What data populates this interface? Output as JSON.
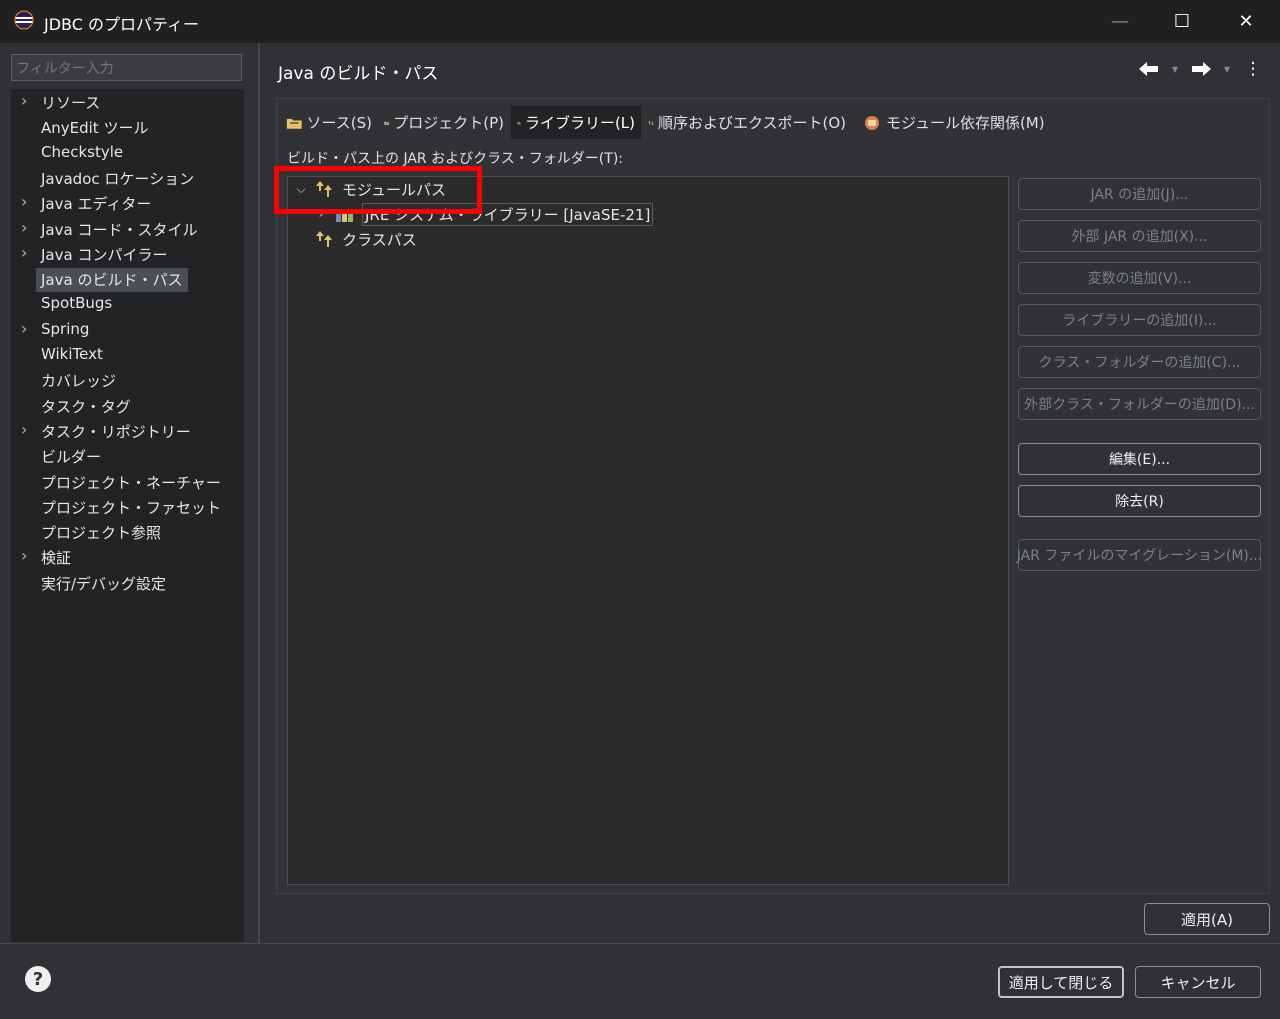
{
  "window": {
    "title": "JDBC のプロパティー",
    "minimize_glyph": "—",
    "maximize_glyph": "☐",
    "close_glyph": "✕"
  },
  "sidebar": {
    "filter_placeholder": "フィルター入力",
    "items": [
      {
        "label": "リソース",
        "expandable": true
      },
      {
        "label": "AnyEdit ツール",
        "expandable": false
      },
      {
        "label": "Checkstyle",
        "expandable": false
      },
      {
        "label": "Javadoc ロケーション",
        "expandable": false
      },
      {
        "label": "Java エディター",
        "expandable": true
      },
      {
        "label": "Java コード・スタイル",
        "expandable": true
      },
      {
        "label": "Java コンパイラー",
        "expandable": true
      },
      {
        "label": "Java のビルド・パス",
        "expandable": false,
        "selected": true
      },
      {
        "label": "SpotBugs",
        "expandable": false
      },
      {
        "label": "Spring",
        "expandable": true
      },
      {
        "label": "WikiText",
        "expandable": false
      },
      {
        "label": "カバレッジ",
        "expandable": false
      },
      {
        "label": "タスク・タグ",
        "expandable": false
      },
      {
        "label": "タスク・リポジトリー",
        "expandable": true
      },
      {
        "label": "ビルダー",
        "expandable": false
      },
      {
        "label": "プロジェクト・ネーチャー",
        "expandable": false
      },
      {
        "label": "プロジェクト・ファセット",
        "expandable": false
      },
      {
        "label": "プロジェクト参照",
        "expandable": false
      },
      {
        "label": "検証",
        "expandable": true
      },
      {
        "label": "実行/デバッグ設定",
        "expandable": false
      }
    ]
  },
  "page": {
    "title": "Java のビルド・パス",
    "back_icon": "arrow-left-icon",
    "forward_icon": "arrow-right-icon",
    "menu_glyph": "⋮",
    "dropdown_glyph": "▾"
  },
  "tabs": [
    {
      "label": "ソース(S)",
      "icon": "source-folder-icon",
      "active": false
    },
    {
      "label": "プロジェクト(P)",
      "icon": "project-icon",
      "active": false
    },
    {
      "label": "ライブラリー(L)",
      "icon": "library-icon",
      "active": true
    },
    {
      "label": "順序およびエクスポート(O)",
      "icon": "order-export-icon",
      "active": false
    },
    {
      "label": "モジュール依存関係(M)",
      "icon": "module-icon",
      "active": false
    }
  ],
  "tree": {
    "label": "ビルド・パス上の JAR およびクラス・フォルダー(T):",
    "rows": [
      {
        "label": "モジュールパス",
        "icon": "modulepath-icon",
        "expanded": true
      },
      {
        "label": "JRE システム・ライブラリー [JavaSE-21]",
        "icon": "jre-library-icon",
        "expanded": false
      },
      {
        "label": "クラスパス",
        "icon": "classpath-icon"
      }
    ]
  },
  "buttons": {
    "add_jar": "JAR の追加(J)...",
    "add_external_jar": "外部 JAR の追加(X)...",
    "add_variable": "変数の追加(V)...",
    "add_library": "ライブラリーの追加(I)...",
    "add_class_folder": "クラス・フォルダーの追加(C)...",
    "add_external_class_folder": "外部クラス・フォルダーの追加(D)...",
    "edit": "編集(E)...",
    "remove": "除去(R)",
    "migrate_jar": "JAR ファイルのマイグレーション(M)...",
    "apply": "適用(A)"
  },
  "footer": {
    "help_icon": "help-icon",
    "apply_close": "適用して閉じる",
    "cancel": "キャンセル"
  },
  "colors": {
    "background": "#2f3135",
    "tree_background": "#2b2b2c",
    "highlight": "#ff0000",
    "titlebar": "#202020"
  }
}
